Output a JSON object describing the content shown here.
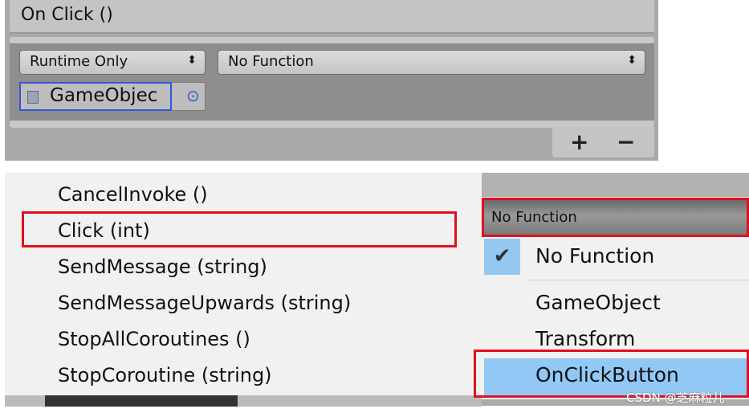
{
  "event_panel": {
    "title": "On Click ()",
    "runtime_dropdown": "Runtime Only",
    "function_dropdown": "No Function",
    "object_field": "GameObjec",
    "add_label": "+",
    "remove_label": "−"
  },
  "method_menu": {
    "items": [
      "CancelInvoke ()",
      "Click (int)",
      "SendMessage (string)",
      "SendMessageUpwards (string)",
      "StopAllCoroutines ()",
      "StopCoroutine (string)"
    ],
    "highlighted": "Click (int)"
  },
  "function_menu": {
    "header": "No Function",
    "items": [
      "No Function",
      "GameObject",
      "Transform",
      "OnClickButton"
    ],
    "checked": "No Function",
    "highlighted": "OnClickButton"
  },
  "watermark": "CSDN @芝麻粒儿",
  "colors": {
    "highlight": "#92c8f6",
    "annotation_red": "#e01020",
    "selection_blue": "#3355dd"
  }
}
